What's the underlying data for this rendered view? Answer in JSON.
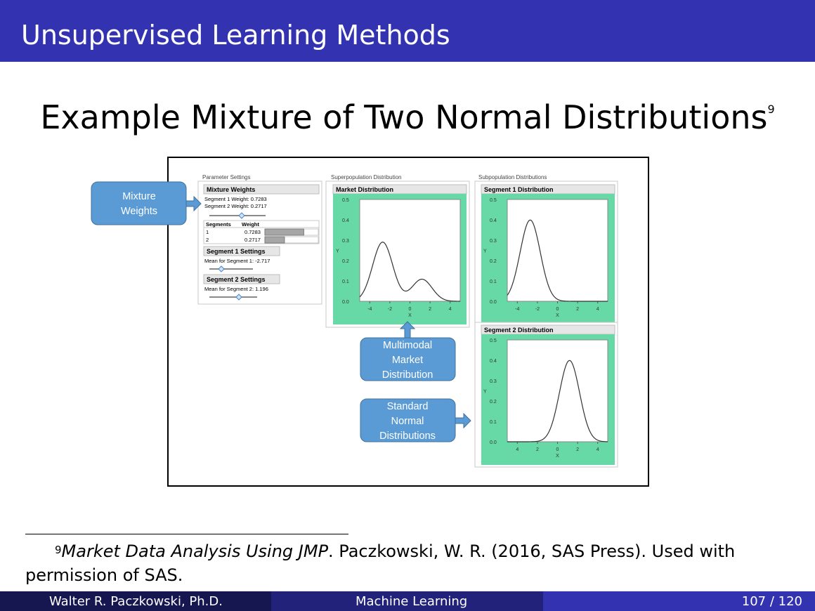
{
  "header": {
    "title": "Unsupervised Learning Methods"
  },
  "slide": {
    "title": "Example Mixture of Two Normal Distributions",
    "footnote_mark": "9"
  },
  "figure": {
    "callouts": {
      "mixture_weights": [
        "Mixture",
        "Weights"
      ],
      "multimodal": [
        "Multimodal",
        "Market",
        "Distribution"
      ],
      "standard_normal": [
        "Standard",
        "Normal",
        "Distributions"
      ]
    },
    "panels": {
      "parameter_settings": {
        "section_label": "Parameter Settings",
        "mixture_weights_title": "Mixture Weights",
        "seg1_weight": "Segment 1 Weight: 0.7283",
        "seg2_weight": "Segment 2 Weight: 0.2717",
        "table_headers": [
          "Segments",
          "Weight"
        ],
        "table_rows": [
          {
            "segment": "1",
            "weight": "0.7283",
            "fraction": 0.7283
          },
          {
            "segment": "2",
            "weight": "0.2717",
            "fraction": 0.2717
          }
        ],
        "seg1_settings_title": "Segment 1 Settings",
        "seg1_mean": "Mean for Segment 1: -2.717",
        "seg2_settings_title": "Segment 2 Settings",
        "seg2_mean": "Mean for Segment 2: 1.196"
      },
      "superpopulation": {
        "section_label": "Superpopulation Distribution",
        "title": "Market Distribution"
      },
      "subpopulation": {
        "section_label": "Subpopulation Distributions",
        "seg1_title": "Segment 1 Distribution",
        "seg2_title": "Segment 2 Distribution"
      }
    }
  },
  "chart_data": [
    {
      "type": "line",
      "title": "Market Distribution",
      "xlabel": "X",
      "ylabel": "Y",
      "xlim": [
        -5,
        5
      ],
      "ylim": [
        0,
        0.5
      ],
      "x_ticks": [
        "-4",
        "-2",
        "0",
        "2",
        "4"
      ],
      "y_ticks": [
        "0.0",
        "0.1",
        "0.2",
        "0.3",
        "0.4",
        "0.5"
      ],
      "components": [
        {
          "weight": 0.7283,
          "mean": -2.717,
          "sd": 1
        },
        {
          "weight": 0.2717,
          "mean": 1.196,
          "sd": 1
        }
      ]
    },
    {
      "type": "line",
      "title": "Segment 1 Distribution",
      "xlabel": "X",
      "ylabel": "Y",
      "xlim": [
        -5,
        5
      ],
      "ylim": [
        0,
        0.5
      ],
      "x_ticks": [
        "-4",
        "-2",
        "0",
        "2",
        "4"
      ],
      "y_ticks": [
        "0.0",
        "0.1",
        "0.2",
        "0.3",
        "0.4",
        "0.5"
      ],
      "components": [
        {
          "weight": 1,
          "mean": -2.717,
          "sd": 1
        }
      ]
    },
    {
      "type": "line",
      "title": "Segment 2 Distribution",
      "xlabel": "X",
      "ylabel": "Y",
      "xlim": [
        -5,
        5
      ],
      "ylim": [
        0,
        0.5
      ],
      "x_ticks": [
        "4",
        "2",
        "0",
        "2",
        "4"
      ],
      "y_ticks": [
        "0.0",
        "0.1",
        "0.2",
        "0.3",
        "0.4",
        "0.5"
      ],
      "components": [
        {
          "weight": 1,
          "mean": 1.196,
          "sd": 1
        }
      ]
    }
  ],
  "footnote": {
    "mark": "9",
    "italic": "Market Data Analysis Using JMP",
    "rest": ". Paczkowski, W. R. (2016, SAS Press). Used with permission of SAS."
  },
  "footer": {
    "author": "Walter R. Paczkowski, Ph.D.",
    "topic": "Machine Learning",
    "page": "107 / 120"
  },
  "colors": {
    "header": "#3333b2",
    "callout": "#5b9bd5",
    "plot_frame": "#66d9a6"
  }
}
